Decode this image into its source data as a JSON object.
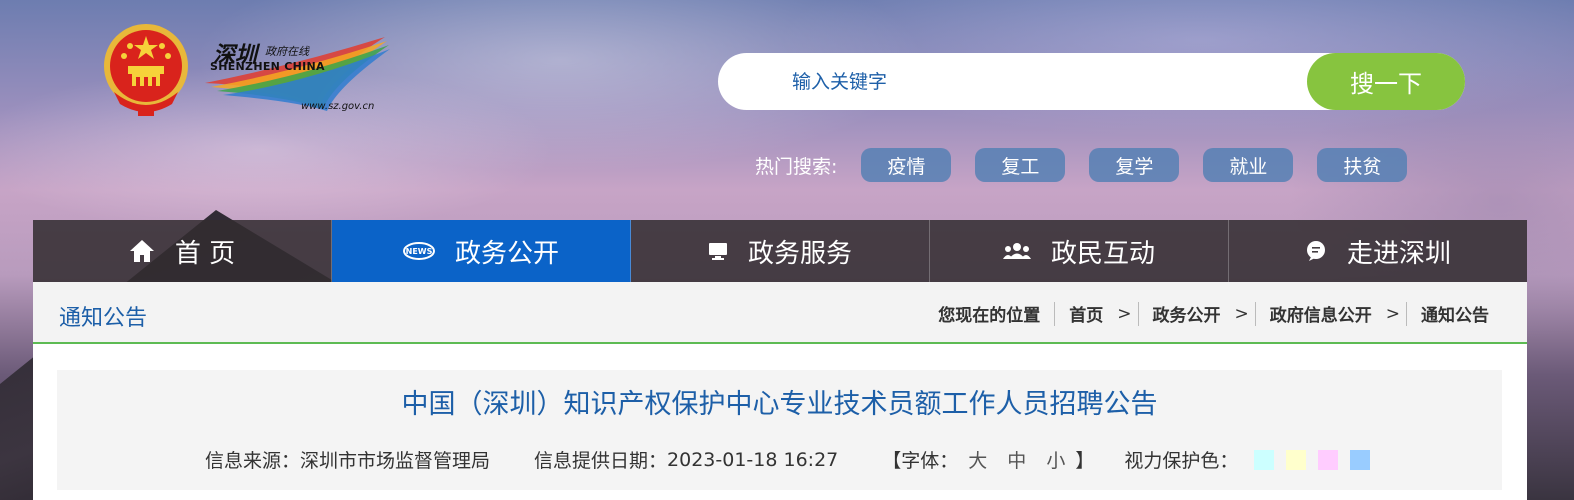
{
  "header": {
    "logo": {
      "name_cn": "深圳",
      "subtitle": "政府在线",
      "name_en": "SHENZHEN CHINA",
      "url": "www.sz.gov.cn"
    },
    "search": {
      "placeholder": "输入关键字",
      "button_label": "搜一下"
    },
    "hot_search": {
      "label": "热门搜索:",
      "tags": [
        "疫情",
        "复工",
        "复学",
        "就业",
        "扶贫"
      ]
    }
  },
  "nav": {
    "items": [
      {
        "label": "首 页",
        "icon": "home-icon"
      },
      {
        "label": "政务公开",
        "icon": "news-icon"
      },
      {
        "label": "政务服务",
        "icon": "monitor-icon"
      },
      {
        "label": "政民互动",
        "icon": "people-icon"
      },
      {
        "label": "走进深圳",
        "icon": "chat-icon"
      }
    ],
    "active_index": 1
  },
  "section": {
    "title": "通知公告"
  },
  "breadcrumb": {
    "label": "您现在的位置",
    "items": [
      "首页",
      "政务公开",
      "政府信息公开",
      "通知公告"
    ]
  },
  "article": {
    "title": "中国（深圳）知识产权保护中心专业技术员额工作人员招聘公告",
    "source_label": "信息来源：",
    "source": "深圳市市场监督管理局",
    "date_label": "信息提供日期：",
    "date": "2023-01-18 16:27",
    "font_size": {
      "open": "【字体：",
      "large": "大",
      "medium": "中",
      "small": "小",
      "close": "】"
    },
    "eye_care_label": "视力保护色：",
    "eye_care_colors": [
      "#ccffff",
      "#ffffcc",
      "#ffccff",
      "#99ccff"
    ]
  },
  "colors": {
    "nav_active": "#0b63c8",
    "search_button": "#87c43f",
    "title_blue": "#1d5fa8",
    "divider_green": "#5dbb53"
  }
}
